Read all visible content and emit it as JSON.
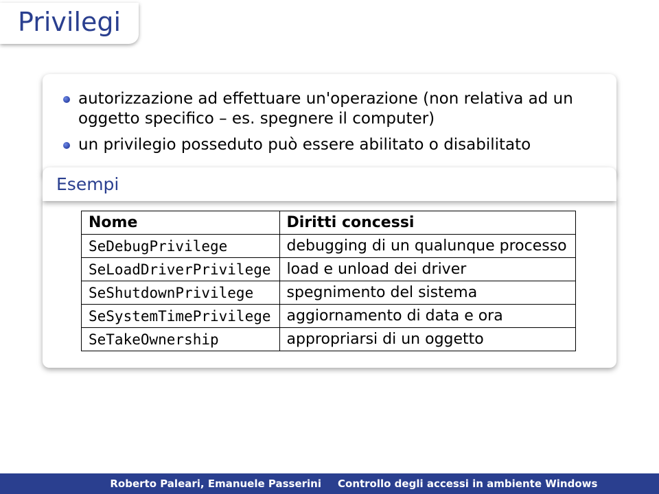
{
  "title": "Privilegi",
  "bullets": [
    "autorizzazione ad effettuare un'operazione (non relativa ad un oggetto specifico – es. spegnere il computer)",
    "un privilegio posseduto può essere abilitato o disabilitato"
  ],
  "example": {
    "heading": "Esempi",
    "headers": {
      "name": "Nome",
      "rights": "Diritti concessi"
    },
    "rows": [
      {
        "name": "SeDebugPrivilege",
        "rights": "debugging di un qualunque processo"
      },
      {
        "name": "SeLoadDriverPrivilege",
        "rights": "load e unload dei driver"
      },
      {
        "name": "SeShutdownPrivilege",
        "rights": "spegnimento del sistema"
      },
      {
        "name": "SeSystemTimePrivilege",
        "rights": "aggiornamento di data e ora"
      },
      {
        "name": "SeTakeOwnership",
        "rights": "appropriarsi di un oggetto"
      }
    ]
  },
  "footer": {
    "left": "Roberto Paleari, Emanuele Passerini",
    "right": "Controllo degli accessi in ambiente Windows"
  }
}
